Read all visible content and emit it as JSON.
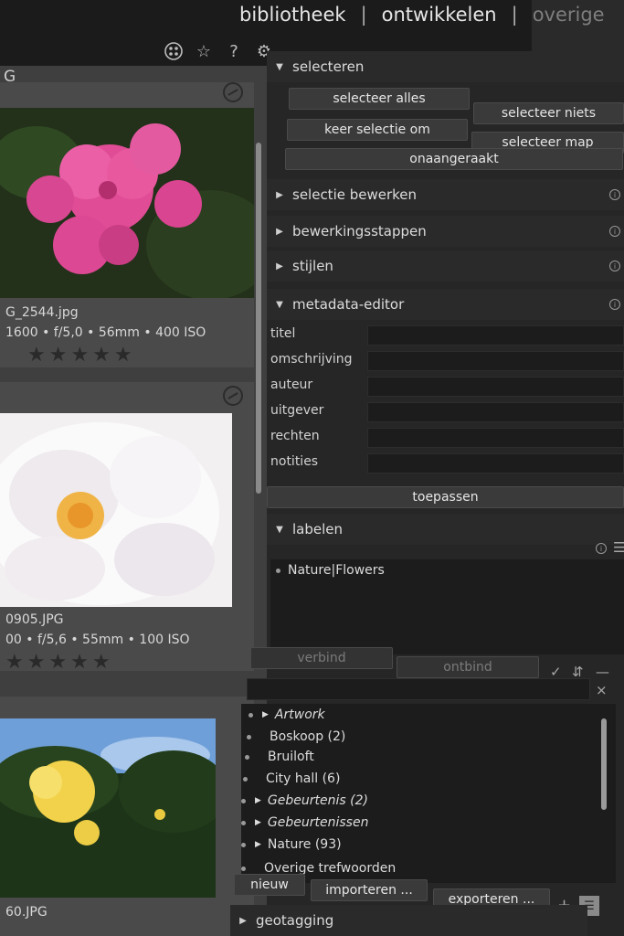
{
  "header": {
    "views": [
      "bibliotheek",
      "ontwikkelen",
      "overige"
    ],
    "separator": "|",
    "toolbar_icons": [
      "view-grid-icon",
      "star-icon",
      "help-icon",
      "gear-icon"
    ]
  },
  "filmstrip": {
    "partial_header": "G",
    "images": [
      {
        "filename": "G_2544.jpg",
        "exif": "1600 • f/5,0 • 56mm • 400 ISO",
        "stars": "★★★★★",
        "subject": "pink roses"
      },
      {
        "filename": "0905.JPG",
        "exif": "00 • f/5,6 • 55mm • 100 ISO",
        "stars": "★★★★★",
        "subject": "white rose"
      },
      {
        "filename": "60.JPG",
        "exif": "",
        "stars": "",
        "subject": "yellow roses"
      }
    ]
  },
  "selecteren": {
    "title": "selecteren",
    "buttons": [
      "selecteer alles",
      "selecteer niets",
      "keer selectie om",
      "selecteer map",
      "onaangeraakt"
    ]
  },
  "collapsed_sections": [
    "selectie bewerken",
    "bewerkingsstappen",
    "stijlen"
  ],
  "metadata": {
    "title": "metadata-editor",
    "fields": [
      "titel",
      "omschrijving",
      "auteur",
      "uitgever",
      "rechten",
      "notities"
    ],
    "apply": "toepassen"
  },
  "labelen": {
    "title": "labelen",
    "attached": [
      "Nature|Flowers"
    ],
    "attach_button": "verbind",
    "detach_button": "ontbind",
    "filter_clear": "×",
    "tags": [
      {
        "label": "Artwork",
        "category": true,
        "expandable": true
      },
      {
        "label": "Boskoop (2)",
        "category": false,
        "expandable": false
      },
      {
        "label": "Bruiloft",
        "category": false,
        "expandable": false
      },
      {
        "label": "City hall (6)",
        "category": false,
        "expandable": false
      },
      {
        "label": "Gebeurtenis (2)",
        "category": true,
        "expandable": true
      },
      {
        "label": "Gebeurtenissen",
        "category": true,
        "expandable": true
      },
      {
        "label": "Nature (93)",
        "category": true,
        "expandable": true
      },
      {
        "label": "Overige trefwoorden",
        "category": false,
        "expandable": false
      }
    ],
    "bottom_buttons": [
      "nieuw",
      "importeren ...",
      "exporteren ..."
    ]
  },
  "geotagging": {
    "title": "geotagging"
  },
  "colors": {
    "bg": "#1e1e1e",
    "panel": "#262626",
    "filmstrip": "#3f3f3f"
  }
}
